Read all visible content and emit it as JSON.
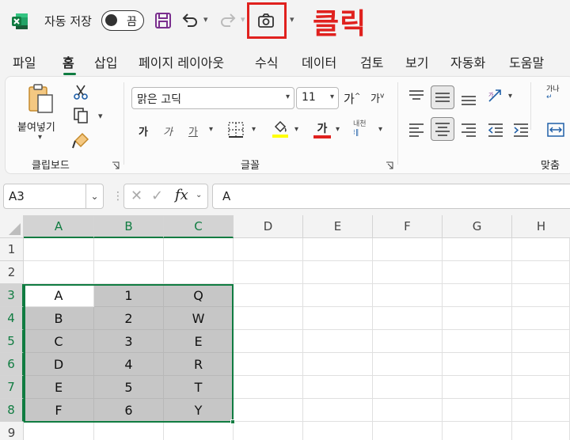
{
  "titlebar": {
    "autosave_label": "자동 저장",
    "autosave_state": "끔",
    "click_annotation": "클릭",
    "accent_color": "#107c41",
    "annotation_color": "#e0211e"
  },
  "tabs": [
    "파일",
    "홈",
    "삽입",
    "페이지 레이아웃",
    "수식",
    "데이터",
    "검토",
    "보기",
    "자동화",
    "도움말"
  ],
  "ribbon": {
    "paste_label": "붙여넣기",
    "clipboard_group": "클립보드",
    "font_name": "맑은 고딕",
    "font_size": "11",
    "grow_font": "가",
    "shrink_font": "가",
    "bold": "가",
    "italic": "가",
    "underline": "가",
    "font_color_glyph": "가",
    "phonetic_glyph": "내천",
    "font_group": "글꼴",
    "alignment_group": "맞춤",
    "wrap_glyph": "가나"
  },
  "formula_bar": {
    "name_box": "A3",
    "fx": "fx",
    "formula_value": "A"
  },
  "grid": {
    "columns": [
      "A",
      "B",
      "C",
      "D",
      "E",
      "F",
      "G",
      "H"
    ],
    "rows": [
      "1",
      "2",
      "3",
      "4",
      "5",
      "6",
      "7",
      "8",
      "9"
    ],
    "cells": [
      [
        "",
        "",
        ""
      ],
      [
        "",
        "",
        ""
      ],
      [
        "A",
        "1",
        "Q"
      ],
      [
        "B",
        "2",
        "W"
      ],
      [
        "C",
        "3",
        "E"
      ],
      [
        "D",
        "4",
        "R"
      ],
      [
        "E",
        "5",
        "T"
      ],
      [
        "F",
        "6",
        "Y"
      ],
      [
        "",
        "",
        ""
      ]
    ]
  }
}
